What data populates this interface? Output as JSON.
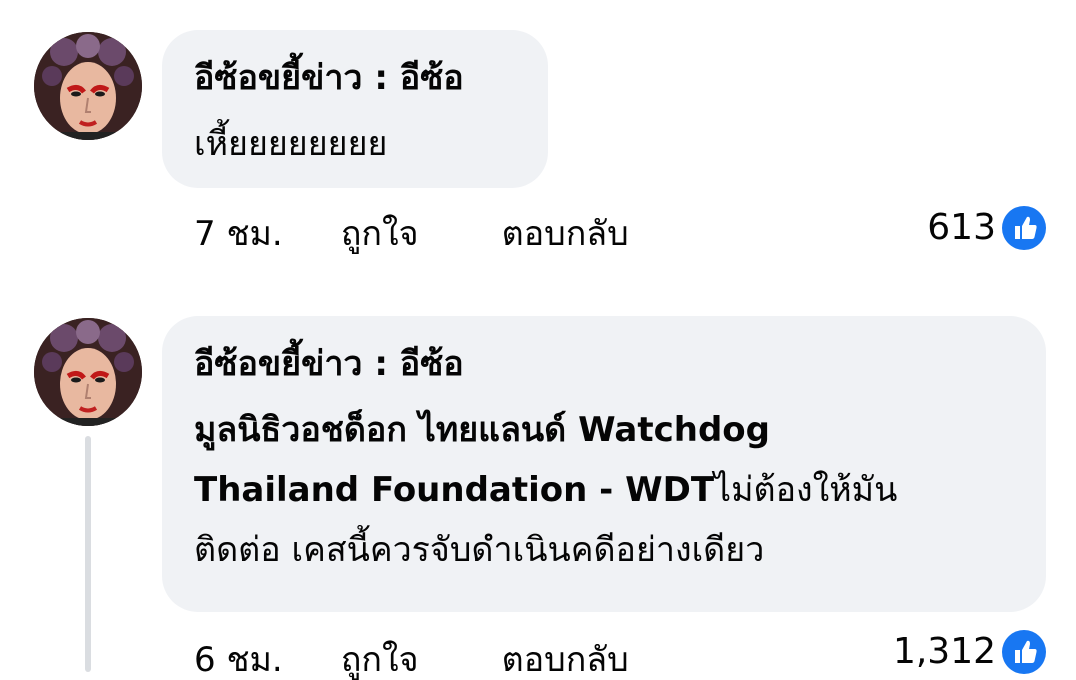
{
  "comments": [
    {
      "author": "อีซ้อขยี้ข่าว : อีซ้อ",
      "text": "เหี้ยยยยยยยย",
      "time": "7 ชม.",
      "like_label": "ถูกใจ",
      "reply_label": "ตอบกลับ",
      "reaction_count": "613",
      "reaction_icon": "like-icon"
    },
    {
      "author": "อีซ้อขยี้ข่าว : อีซ้อ",
      "mention": "มูลนิธิวอชด็อก ไทยแลนด์ Watchdog Thailand Foundation - WDT",
      "text_line1_bold": "มูลนิธิวอชด็อก ไทยแลนด์ Watchdog",
      "text_line2_bold": "Thailand Foundation - WDT",
      "text_line2_rest": "ไม่ต้องให้มัน",
      "text_line3": "ติดต่อ เคสนี้ควรจับดำเนินคดีอย่างเดียว",
      "time": "6 ชม.",
      "like_label": "ถูกใจ",
      "reply_label": "ตอบกลับ",
      "reaction_count": "1,312",
      "reaction_icon": "like-icon"
    }
  ],
  "colors": {
    "bubble": "#f0f2f5",
    "text": "#050505",
    "like_blue": "#1877f2",
    "thread_line": "#dadde1"
  }
}
